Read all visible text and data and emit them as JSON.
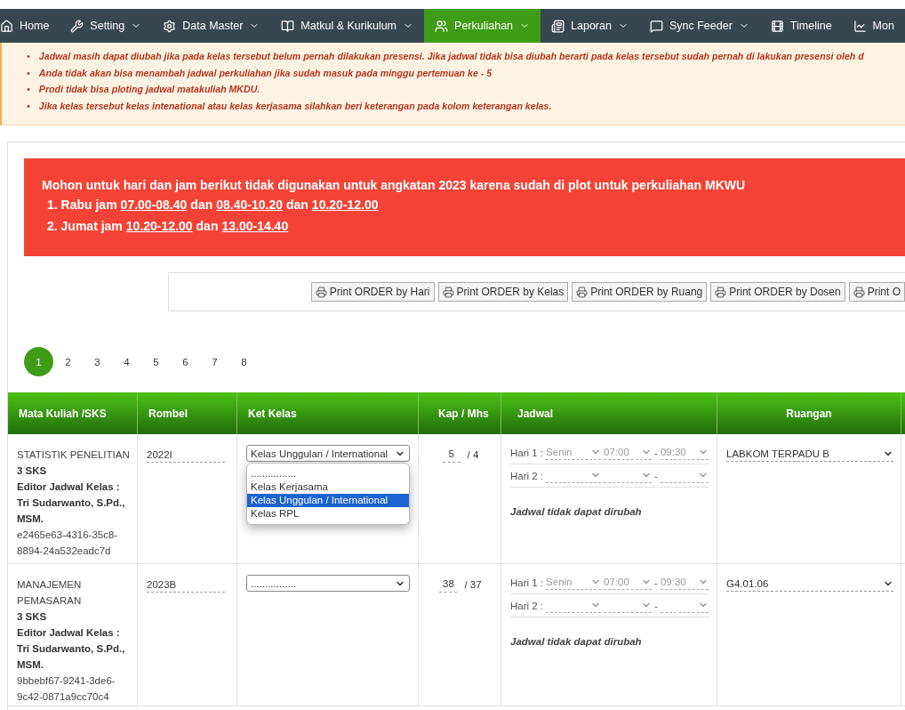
{
  "nav": [
    {
      "label": "Home",
      "caret": false,
      "selected": false
    },
    {
      "label": "Setting",
      "caret": true,
      "selected": false
    },
    {
      "label": "Data Master",
      "caret": true,
      "selected": false
    },
    {
      "label": "Matkul & Kurikulum",
      "caret": true,
      "selected": false
    },
    {
      "label": "Perkuliahan",
      "caret": true,
      "selected": true
    },
    {
      "label": "Laporan",
      "caret": true,
      "selected": false
    },
    {
      "label": "Sync Feeder",
      "caret": true,
      "selected": false
    },
    {
      "label": "Timeline",
      "caret": false,
      "selected": false
    },
    {
      "label": "Mon",
      "caret": false,
      "selected": false
    }
  ],
  "notices": [
    {
      "marker": "•",
      "text": "Jadwal masih dapat diubah jika pada kelas tersebut belum pernah dilakukan presensi. Jika jadwal tidak bisa diubah berarti pada kelas tersebut sudah pernah di lakukan presensi oleh d"
    },
    {
      "marker": "•",
      "text": "Anda tidak akan bisa menambah jadwal perkuliahan jika sudah masuk pada minggu pertemuan ke - 5"
    },
    {
      "marker": "•",
      "text": "Prodi tidak bisa ploting jadwal matakuliah MKDU."
    },
    {
      "marker": "•",
      "text": "Jika kelas tersebut kelas intenational atau kelas kerjasama silahkan beri keterangan pada kolom keterangan kelas."
    }
  ],
  "alert": {
    "title": "Mohon untuk hari dan jam berikut tidak digunakan untuk angkatan 2023 karena sudah di plot untuk perkuliahan MKWU",
    "lines": [
      [
        {
          "text": "1. Rabu jam",
          "link": false
        },
        {
          "text": "07.00-08.40",
          "link": true
        },
        {
          "text": "dan",
          "link": false
        },
        {
          "text": "08.40-10.20",
          "link": true
        },
        {
          "text": "dan",
          "link": false
        },
        {
          "text": "10.20-12.00",
          "link": true
        }
      ],
      [
        {
          "text": "2. Jumat jam",
          "link": false
        },
        {
          "text": "10.20-12.00",
          "link": true
        },
        {
          "text": "dan",
          "link": false
        },
        {
          "text": "13.00-14.40",
          "link": true
        }
      ]
    ]
  },
  "print_buttons": [
    "Print ORDER by Hari",
    "Print ORDER by Kelas",
    "Print ORDER by Ruang",
    "Print ORDER by Dosen",
    "Print O"
  ],
  "pagination": [
    {
      "label": "1",
      "selected": true
    },
    {
      "label": "2",
      "selected": false
    },
    {
      "label": "3",
      "selected": false
    },
    {
      "label": "4",
      "selected": false
    },
    {
      "label": "5",
      "selected": false
    },
    {
      "label": "6",
      "selected": false
    },
    {
      "label": "7",
      "selected": false
    },
    {
      "label": "8",
      "selected": false
    }
  ],
  "table": {
    "columns": [
      "Mata Kuliah /SKS",
      "Rombel",
      "Ket Kelas",
      "Kap / Mhs",
      "Jadwal",
      "Ruangan"
    ],
    "rows": [
      {
        "course": "STATISTIK PENELITIAN",
        "sks": "3 SKS",
        "editor_label": "Editor Jadwal Kelas :",
        "editor_name": "Tri Sudarwanto, S.Pd., MSM.",
        "id": "e2465e63-4316-35c8-8894-24a532eadc7d",
        "rombel": "2022I",
        "ket_kelas": {
          "value": "Kelas Unggulan / International",
          "expanded": true,
          "options": [
            {
              "label": "................",
              "selected": false
            },
            {
              "label": "Kelas Kerjasama",
              "selected": false
            },
            {
              "label": "Kelas Unggulan / International",
              "selected": true
            },
            {
              "label": "Kelas RPL",
              "selected": false
            }
          ]
        },
        "kap": "5",
        "mhs": "/ 4",
        "jadwal": [
          {
            "label": "Hari 1 :",
            "day": "Senin",
            "start": "07:00",
            "sep": "-",
            "end": "09:30"
          },
          {
            "label": "Hari 2 :",
            "sep": "-"
          }
        ],
        "note": "Jadwal tidak dapat dirubah",
        "ruangan": "LABKOM TERPADU B"
      },
      {
        "course": "MANAJEMEN PEMASARAN",
        "sks": "3 SKS",
        "editor_label": "Editor Jadwal Kelas :",
        "editor_name": "Tri Sudarwanto, S.Pd., MSM.",
        "id": "9bbebf67-9241-3de6-9c42-0871a9cc70c4",
        "rombel": "2023B",
        "ket_kelas": {
          "value": "................"
        },
        "kap": "38",
        "mhs": "/ 37",
        "jadwal": [
          {
            "label": "Hari 1 :",
            "day": "Senin",
            "start": "07:00",
            "sep": "-",
            "end": "09:30"
          },
          {
            "label": "Hari 2 :",
            "sep": "-"
          }
        ],
        "note": "Jadwal tidak dapat dirubah",
        "ruangan": "G4.01.06"
      }
    ]
  }
}
